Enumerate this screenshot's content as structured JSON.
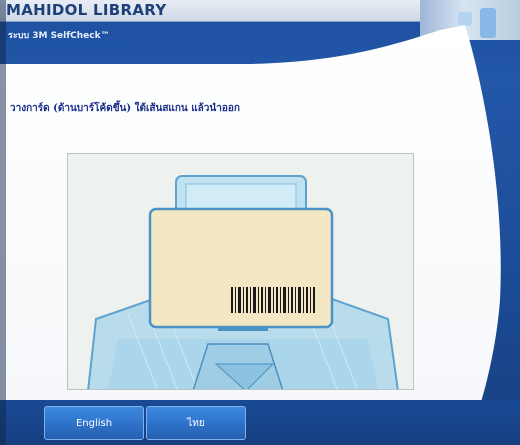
{
  "header": {
    "library_name": "MAHIDOL LIBRARY",
    "app_name": "ระบบ 3M SelfCheck™"
  },
  "main": {
    "instruction": "วางการ์ด (ด้านบาร์โค้ดขึ้น) ใต้เส้นสแกน แล้วนำออก"
  },
  "language_buttons": [
    {
      "label": "English"
    },
    {
      "label": "ไทย"
    }
  ],
  "colors": {
    "brand_blue": "#2357a8",
    "button_blue": "#2e71c9",
    "instruction_text": "#1c2f8c",
    "panel_white": "#ffffff"
  },
  "icons": {
    "illustration": "card-barcode-scanner-illustration"
  }
}
